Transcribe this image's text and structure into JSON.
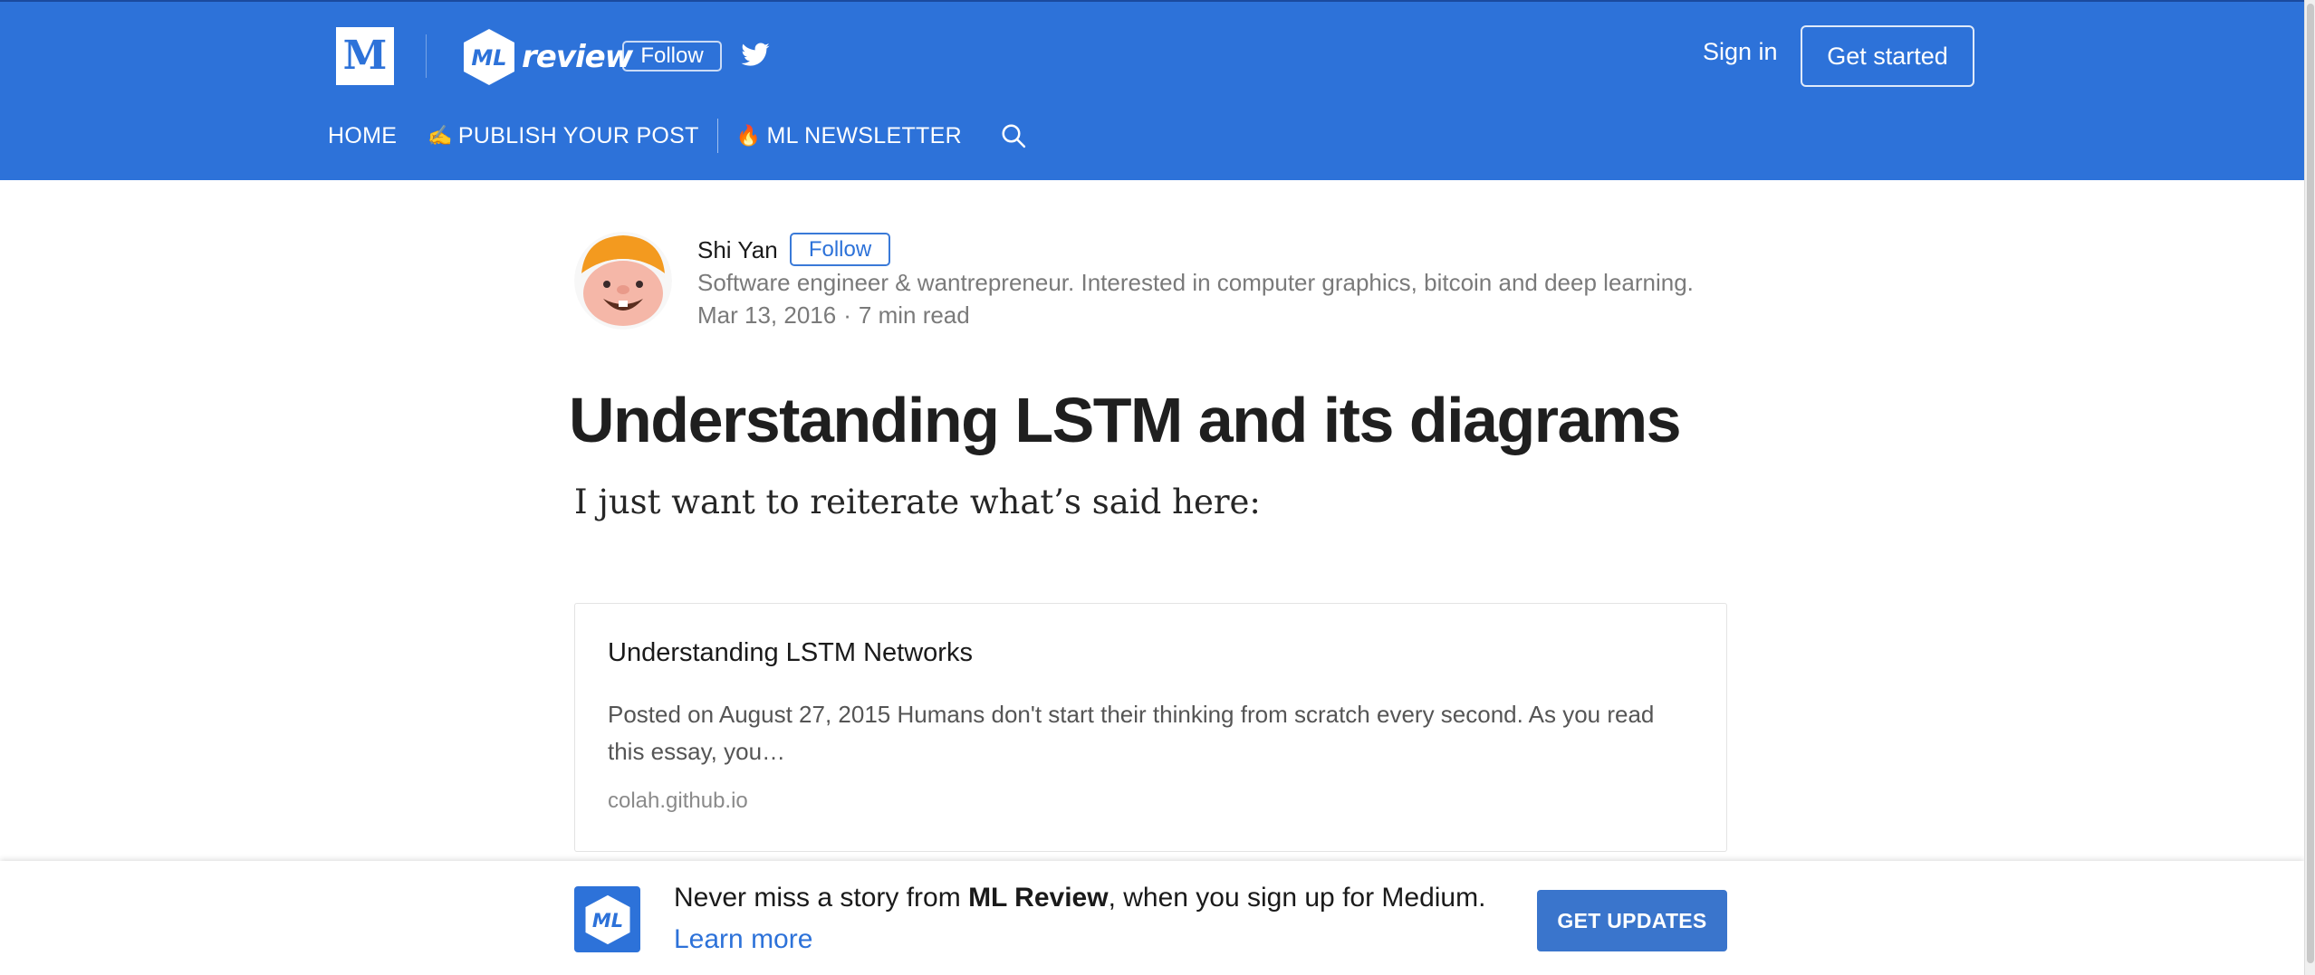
{
  "header": {
    "medium_logo": "M",
    "publication_wordmark": "review",
    "publication_badge": "ML",
    "follow_label": "Follow",
    "signin_label": "Sign in",
    "getstarted_label": "Get started",
    "colors": {
      "bar": "#2d72d9",
      "text": "#ffffff"
    }
  },
  "nav": {
    "items": [
      {
        "label": "HOME",
        "emoji": ""
      },
      {
        "label": "PUBLISH YOUR POST",
        "emoji": "✍"
      },
      {
        "label": "ML NEWSLETTER",
        "emoji": "🔥"
      }
    ],
    "search_icon": "search-icon"
  },
  "author": {
    "name": "Shi Yan",
    "follow_label": "Follow",
    "bio": "Software engineer & wantrepreneur. Interested in computer graphics, bitcoin and deep learning.",
    "date": "Mar 13, 2016",
    "separator": "·",
    "read_time": "7 min read"
  },
  "article": {
    "title": "Understanding LSTM and its diagrams",
    "lead": "I just want to reiterate what’s said here:",
    "embed": {
      "title": "Understanding LSTM Networks",
      "description": "Posted on August 27, 2015 Humans don't start their thinking from scratch every second. As you read this essay, you…",
      "domain": "colah.github.io"
    }
  },
  "banner": {
    "badge": "ML",
    "text_before": "Never miss a story from ",
    "publication": "ML Review",
    "text_after": ", when you sign up for Medium.",
    "learn_more": "Learn more",
    "cta": "GET UPDATES",
    "accent": "#3a75cc"
  }
}
